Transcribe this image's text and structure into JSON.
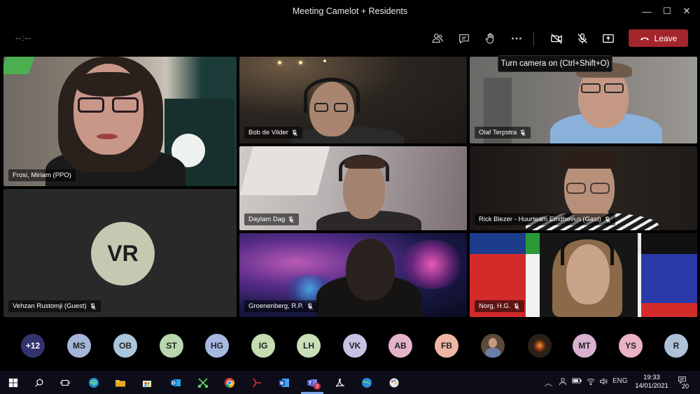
{
  "window": {
    "title": "Meeting Camelot + Residents",
    "minimize_glyph": "—",
    "maximize_glyph": "☐",
    "close_glyph": "✕"
  },
  "toolbar": {
    "timer": "--:--",
    "buttons": [
      {
        "name": "participants-icon"
      },
      {
        "name": "chat-icon"
      },
      {
        "name": "raise-hand-icon"
      },
      {
        "name": "more-options-icon"
      },
      {
        "name": "camera-off-icon"
      },
      {
        "name": "mic-off-icon"
      },
      {
        "name": "share-screen-icon"
      }
    ],
    "leave_label": "Leave",
    "leave_color": "#a4262c",
    "tooltip": "Turn camera on (Ctrl+Shift+O)"
  },
  "tiles": [
    {
      "name": "Frosi, Miriam (PPO)"
    },
    {
      "name": "Vehzan Rustomji (Guest)",
      "initials": "VR",
      "avatar_color": "#c4cab2"
    },
    {
      "name": "Bob de Vilder"
    },
    {
      "name": "Olaf Terpstra"
    },
    {
      "name": "Daylam Dag"
    },
    {
      "name": "Rick Blezer - Huurteam Eindhoven (Gast)"
    },
    {
      "name": "Groenenberg, R.P."
    },
    {
      "name": "Norg, H.G."
    }
  ],
  "participants": [
    {
      "initials": "+12",
      "color": "#32336e",
      "text_color": "#ffffff"
    },
    {
      "initials": "MS",
      "color": "#a6b6d9"
    },
    {
      "initials": "OB",
      "color": "#a9c6dc"
    },
    {
      "initials": "ST",
      "color": "#b9d6b0"
    },
    {
      "initials": "HG",
      "color": "#a6b8e0"
    },
    {
      "initials": "IG",
      "color": "#c4dcb0"
    },
    {
      "initials": "LH",
      "color": "#c8e0b8"
    },
    {
      "initials": "VK",
      "color": "#c6c2e4"
    },
    {
      "initials": "AB",
      "color": "#e5b3c9"
    },
    {
      "initials": "FB",
      "color": "#efb6a6"
    },
    {
      "initials": "",
      "color": "#5b4a3a",
      "photo": true
    },
    {
      "initials": "",
      "color": "#2a2018",
      "photo": true
    },
    {
      "initials": "MT",
      "color": "#d8b0d0"
    },
    {
      "initials": "YS",
      "color": "#e9b2c6"
    },
    {
      "initials": "R",
      "color": "#aec1d8"
    }
  ],
  "taskbar": {
    "language": "ENG",
    "time": "19:33",
    "date": "14/01/2021",
    "notifications": "20",
    "teams_badge": "3"
  }
}
